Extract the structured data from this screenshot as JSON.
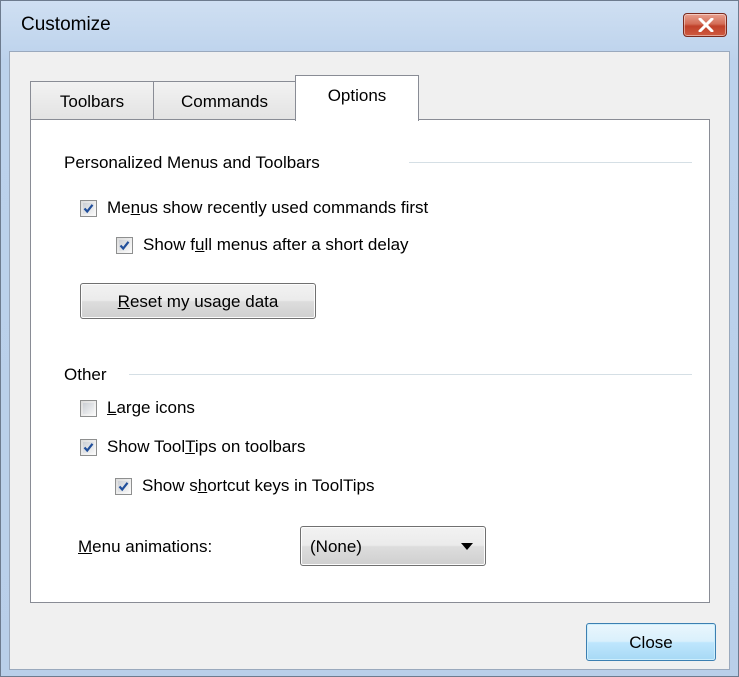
{
  "window": {
    "title": "Customize"
  },
  "tabs": [
    {
      "label": "Toolbars",
      "active": false
    },
    {
      "label": "Commands",
      "active": false
    },
    {
      "label": "Options",
      "active": true
    }
  ],
  "personalized": {
    "group_label": "Personalized Menus and Toolbars",
    "menus_recent": {
      "pre": "Me",
      "accel": "n",
      "post": "us show recently used commands first",
      "checked": true
    },
    "full_menus": {
      "pre": "Show f",
      "accel": "u",
      "post": "ll menus after a short delay",
      "checked": true
    },
    "reset_button": {
      "pre": "",
      "accel": "R",
      "post": "eset my usage data"
    }
  },
  "other": {
    "group_label": "Other",
    "large_icons": {
      "pre": "",
      "accel": "L",
      "post": "arge icons",
      "checked": false
    },
    "show_tooltips": {
      "pre": "Show Tool",
      "accel": "T",
      "post": "ips on toolbars",
      "checked": true
    },
    "shortcut_keys": {
      "pre": "Show s",
      "accel": "h",
      "post": "ortcut keys in ToolTips",
      "checked": true
    },
    "menu_animations": {
      "label_pre": "",
      "label_accel": "M",
      "label_post": "enu animations:",
      "selected": "(None)"
    }
  },
  "footer": {
    "close_label": "Close"
  },
  "colors": {
    "title_bg": "#bcd2ec",
    "client_bg": "#f0f0f0",
    "close_red": "#c0412a",
    "default_button": "#bee6fd",
    "check_blue": "#214f9b"
  }
}
